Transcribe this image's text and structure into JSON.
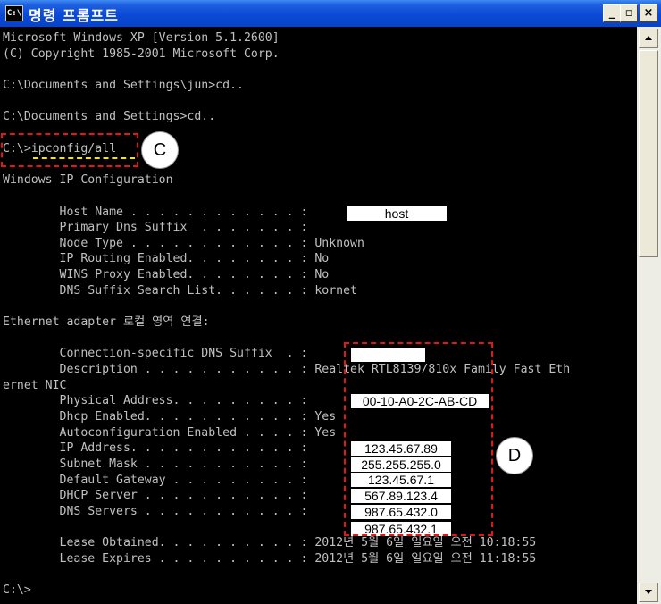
{
  "window": {
    "title": "명령 프롬프트",
    "icon_text": "C:\\",
    "buttons": {
      "minimize": "_",
      "maximize": "▫",
      "close": "×"
    }
  },
  "console": {
    "lines": [
      "Microsoft Windows XP [Version 5.1.2600]",
      "(C) Copyright 1985-2001 Microsoft Corp.",
      "",
      "C:\\Documents and Settings\\jun>cd..",
      "",
      "C:\\Documents and Settings>cd..",
      "",
      "C:\\>ipconfig/all",
      "",
      "Windows IP Configuration",
      "",
      "        Host Name . . . . . . . . . . . . :",
      "        Primary Dns Suffix  . . . . . . . :",
      "        Node Type . . . . . . . . . . . . : Unknown",
      "        IP Routing Enabled. . . . . . . . : No",
      "        WINS Proxy Enabled. . . . . . . . : No",
      "        DNS Suffix Search List. . . . . . : kornet",
      "",
      "Ethernet adapter 로컬 영역 연결:",
      "",
      "        Connection-specific DNS Suffix  . :",
      "        Description . . . . . . . . . . . : Realtek RTL8139/810x Family Fast Eth",
      "ernet NIC",
      "        Physical Address. . . . . . . . . :",
      "        Dhcp Enabled. . . . . . . . . . . : Yes",
      "        Autoconfiguration Enabled . . . . : Yes",
      "        IP Address. . . . . . . . . . . . :",
      "        Subnet Mask . . . . . . . . . . . :",
      "        Default Gateway . . . . . . . . . :",
      "        DHCP Server . . . . . . . . . . . :",
      "        DNS Servers . . . . . . . . . . . :",
      "",
      "        Lease Obtained. . . . . . . . . . : 2012년 5월 6일 일요일 오전 10:18:55",
      "        Lease Expires . . . . . . . . . . : 2012년 5월 6일 일요일 오전 11:18:55",
      "",
      "C:\\>"
    ]
  },
  "values": {
    "host_name": "host",
    "dns_suffix": "",
    "physical_address": "00-10-A0-2C-AB-CD",
    "ip_address": "123.45.67.89",
    "subnet_mask": "255.255.255.0",
    "default_gateway": "123.45.67.1",
    "dhcp_server": "567.89.123.4",
    "dns_server_1": "987.65.432.0",
    "dns_server_2": "987.65.432.1"
  },
  "annotations": {
    "marker_c": "C",
    "marker_d": "D"
  },
  "colors": {
    "console_bg": "#000000",
    "console_text": "#c0c0c0",
    "annotation_red": "#e01818",
    "annotation_yellow": "#f4e21d",
    "titlebar_blue": "#0a4ad6"
  }
}
